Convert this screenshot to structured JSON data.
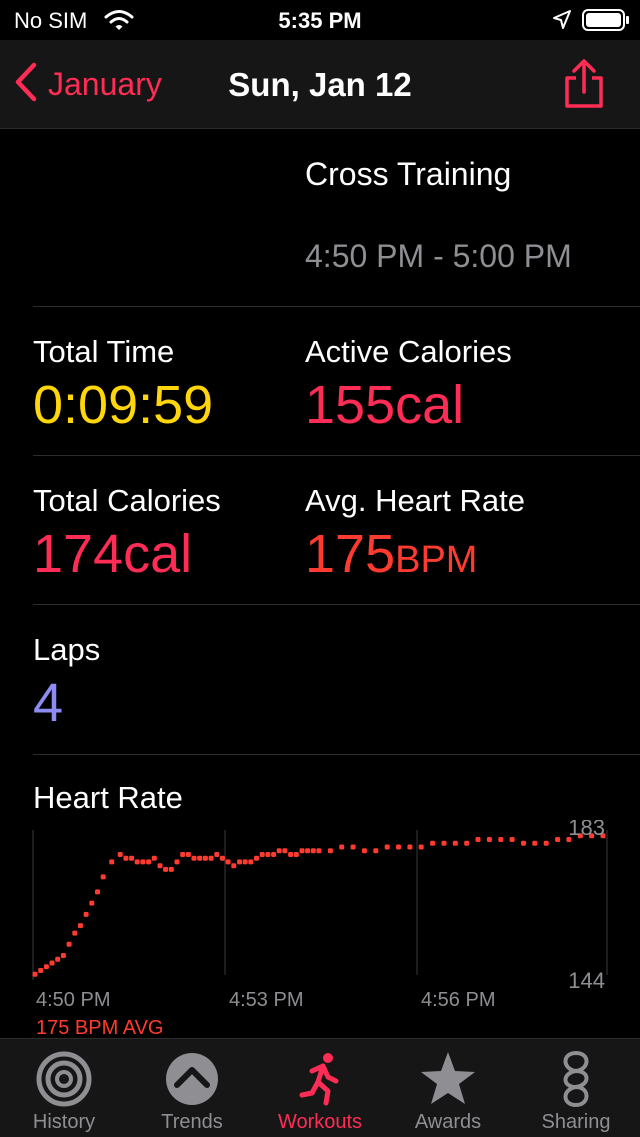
{
  "status_bar": {
    "carrier": "No SIM",
    "time": "5:35 PM"
  },
  "nav": {
    "back_label": "January",
    "title": "Sun, Jan 12"
  },
  "workout": {
    "name": "Cross Training",
    "time_range": "4:50 PM - 5:00 PM"
  },
  "metrics": {
    "total_time": {
      "label": "Total Time",
      "value": "0:09:59"
    },
    "active_calories": {
      "label": "Active Calories",
      "value": "155cal"
    },
    "total_calories": {
      "label": "Total Calories",
      "value": "174cal"
    },
    "avg_heart_rate": {
      "label": "Avg. Heart Rate",
      "value": "175",
      "unit": "BPM"
    },
    "laps": {
      "label": "Laps",
      "value": "4"
    }
  },
  "heart_rate": {
    "title": "Heart Rate",
    "average_label": "175 BPM AVG"
  },
  "colors": {
    "accent": "#ff2d55",
    "time_yellow": "#ffd60a",
    "heart_orange": "#ff3b30",
    "laps_purple": "#8e8cf3",
    "secondary_text": "#8e8e93"
  },
  "chart_data": {
    "type": "scatter",
    "title": "Heart Rate",
    "xlabel": "",
    "ylabel": "",
    "x_tick_labels": [
      "4:50 PM",
      "4:53 PM",
      "4:56 PM"
    ],
    "y_tick_labels": [
      "183",
      "144"
    ],
    "ylim": [
      144,
      183
    ],
    "xlim": [
      0,
      10
    ],
    "annotation": "175 BPM AVG",
    "series": [
      {
        "x": [
          0.0,
          0.1,
          0.2,
          0.3,
          0.4,
          0.5,
          0.6,
          0.7,
          0.8,
          0.9,
          1.0,
          1.1,
          1.2,
          1.35,
          1.5,
          1.6,
          1.7,
          1.8,
          1.9,
          2.0,
          2.1,
          2.2,
          2.3,
          2.4,
          2.5,
          2.6,
          2.7,
          2.8,
          2.9,
          3.0,
          3.1,
          3.2,
          3.3,
          3.4,
          3.5,
          3.6,
          3.7,
          3.8,
          3.9,
          4.0,
          4.1,
          4.2,
          4.3,
          4.4,
          4.5,
          4.6,
          4.7,
          4.8,
          4.9,
          5.0,
          5.2,
          5.4,
          5.6,
          5.8,
          6.0,
          6.2,
          6.4,
          6.6,
          6.8,
          7.0,
          7.2,
          7.4,
          7.6,
          7.8,
          8.0,
          8.2,
          8.4,
          8.6,
          8.8,
          9.0,
          9.2,
          9.4,
          9.6,
          9.8,
          10.0
        ],
        "y": [
          145,
          146,
          147,
          148,
          149,
          150,
          153,
          156,
          158,
          161,
          164,
          167,
          171,
          175,
          177,
          176,
          176,
          175,
          175,
          175,
          176,
          174,
          173,
          173,
          175,
          177,
          177,
          176,
          176,
          176,
          176,
          177,
          176,
          175,
          174,
          175,
          175,
          175,
          176,
          177,
          177,
          177,
          178,
          178,
          177,
          177,
          178,
          178,
          178,
          178,
          178,
          179,
          179,
          178,
          178,
          179,
          179,
          179,
          179,
          180,
          180,
          180,
          180,
          181,
          181,
          181,
          181,
          180,
          180,
          180,
          181,
          181,
          182,
          182,
          182
        ]
      }
    ]
  },
  "tabs": [
    {
      "label": "History",
      "icon": "history-icon"
    },
    {
      "label": "Trends",
      "icon": "trends-icon"
    },
    {
      "label": "Workouts",
      "icon": "workouts-icon"
    },
    {
      "label": "Awards",
      "icon": "awards-icon"
    },
    {
      "label": "Sharing",
      "icon": "sharing-icon"
    }
  ]
}
